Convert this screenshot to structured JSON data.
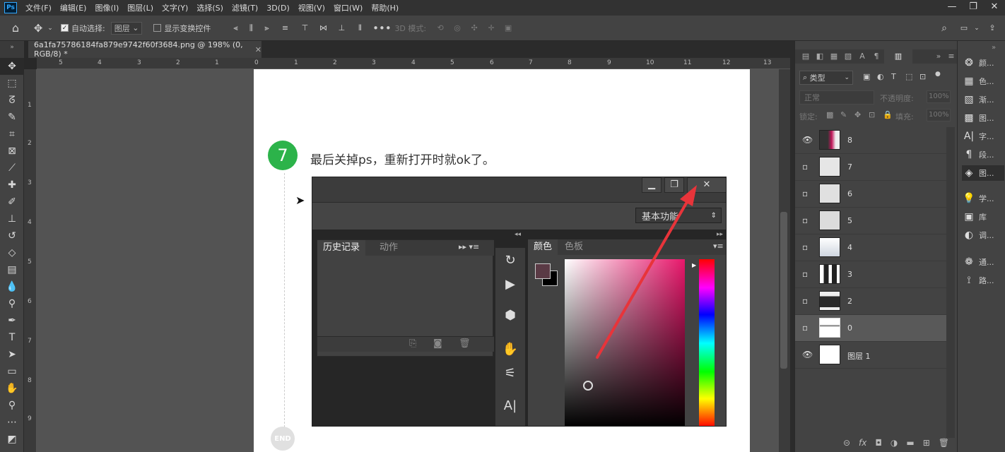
{
  "app": {
    "logo": "Ps",
    "menus": [
      "文件(F)",
      "编辑(E)",
      "图像(I)",
      "图层(L)",
      "文字(Y)",
      "选择(S)",
      "滤镜(T)",
      "3D(D)",
      "视图(V)",
      "窗口(W)",
      "帮助(H)"
    ]
  },
  "options": {
    "auto_select_label": "自动选择:",
    "auto_select_value": "图层",
    "show_transform_label": "显示变换控件",
    "mode3d_label": "3D 模式:"
  },
  "document": {
    "tab_title": "6a1fa75786184fa879e9742f60f3684.png @ 198% (0, RGB/8) *"
  },
  "rulers": {
    "h": [
      "5",
      "4",
      "3",
      "2",
      "1",
      "0",
      "1",
      "2",
      "3",
      "4",
      "5",
      "6",
      "7",
      "8",
      "9",
      "10",
      "11",
      "12",
      "13"
    ],
    "v": [
      "1",
      "2",
      "3",
      "4",
      "5",
      "6",
      "7",
      "8",
      "9"
    ]
  },
  "content": {
    "step_number": "7",
    "step_text": "最后关掉ps，重新打开时就ok了。",
    "end_label": "END"
  },
  "embedded": {
    "workspace": "基本功能",
    "hist_tabs": [
      "历史记录",
      "动作"
    ],
    "color_tabs": [
      "颜色",
      "色板"
    ]
  },
  "layers_panel": {
    "filter_kind": "类型",
    "blend_mode": "正常",
    "opacity_label": "不透明度:",
    "opacity_value": "100%",
    "lock_label": "锁定:",
    "fill_label": "填充:",
    "fill_value": "100%",
    "layers": [
      {
        "name": "8",
        "visible": true,
        "selected": false
      },
      {
        "name": "7",
        "visible": false,
        "selected": false
      },
      {
        "name": "6",
        "visible": false,
        "selected": false
      },
      {
        "name": "5",
        "visible": false,
        "selected": false
      },
      {
        "name": "4",
        "visible": false,
        "selected": false
      },
      {
        "name": "3",
        "visible": false,
        "selected": false
      },
      {
        "name": "2",
        "visible": false,
        "selected": false
      },
      {
        "name": "0",
        "visible": false,
        "selected": true
      },
      {
        "name": "图层 1",
        "visible": true,
        "selected": false
      }
    ]
  },
  "side_icons": [
    {
      "icon": "color-icon",
      "label": "颜..."
    },
    {
      "icon": "swatches-icon",
      "label": "色..."
    },
    {
      "icon": "gradient-icon",
      "label": "渐..."
    },
    {
      "icon": "patterns-icon",
      "label": "图..."
    },
    {
      "icon": "character-icon",
      "label": "字..."
    },
    {
      "icon": "paragraph-icon",
      "label": "段..."
    },
    {
      "icon": "layers-icon",
      "label": "图..."
    },
    {
      "icon": "learn-icon",
      "label": "学..."
    },
    {
      "icon": "libraries-icon",
      "label": "库"
    },
    {
      "icon": "adjustments-icon",
      "label": "调..."
    },
    {
      "icon": "channels-icon",
      "label": "通..."
    },
    {
      "icon": "paths-icon",
      "label": "路..."
    }
  ],
  "colors": {
    "accent_green": "#2cb34a",
    "arrow_red": "#e8343a"
  }
}
